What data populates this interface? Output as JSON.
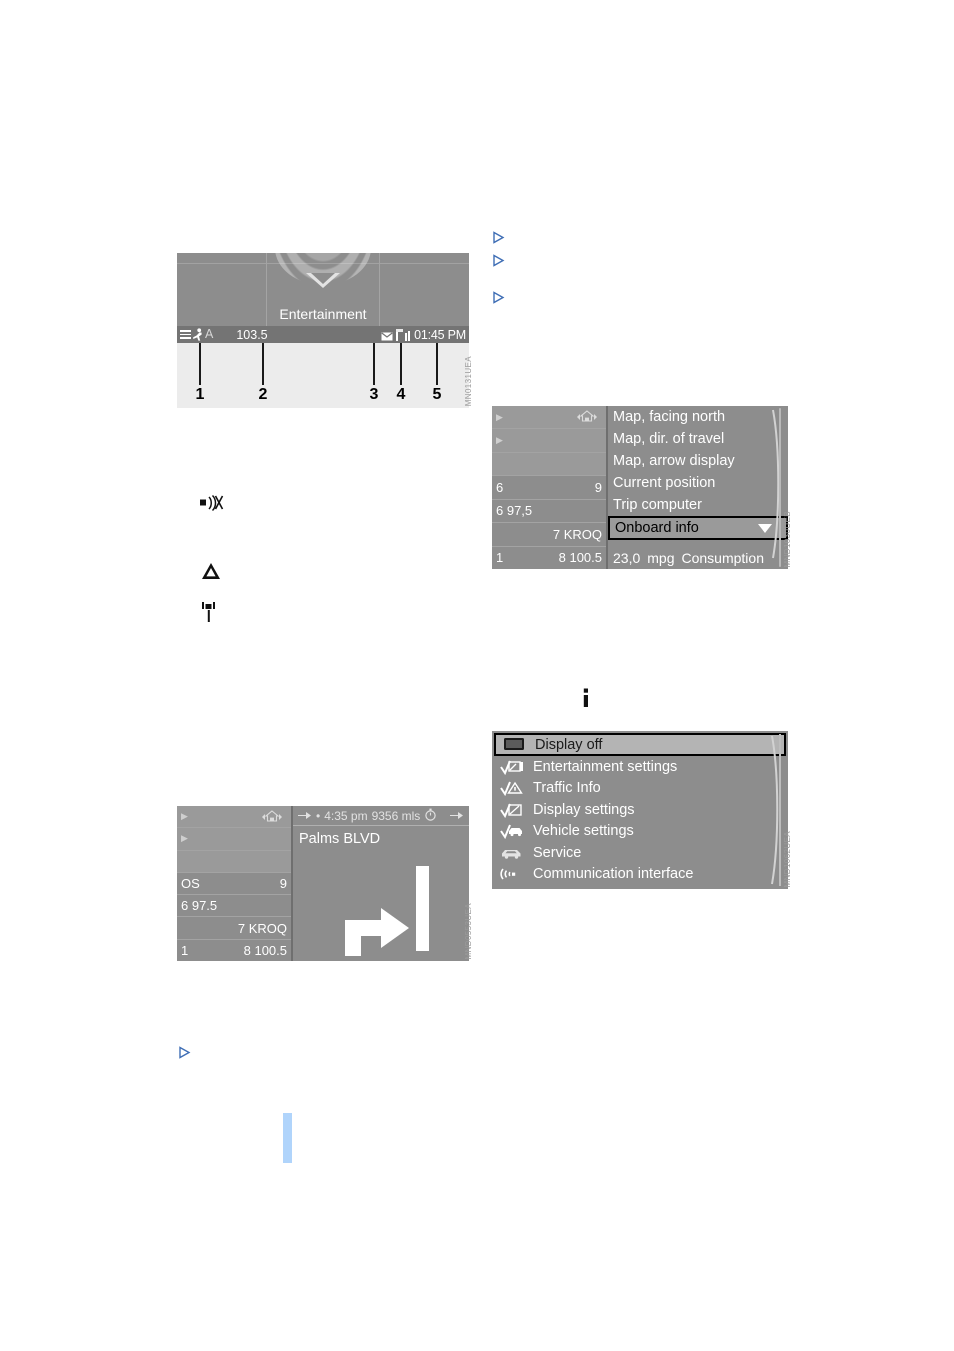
{
  "figures": {
    "status_bar": {
      "id": "fig-statusbar",
      "caption_code": "MN0131UEA",
      "tile_label": "Entertainment",
      "status": {
        "menu_icon": "hamburger-icon",
        "person_icon": "person-icon",
        "letter": "A",
        "frequency": "103.5",
        "envelope_icon": "envelope-icon",
        "signal_icon": "signal-bars-icon",
        "time": "01:45 PM"
      },
      "callouts": [
        "1",
        "2",
        "3",
        "4",
        "5"
      ]
    },
    "nav_menu": {
      "id": "fig-navmenu",
      "caption_code": "MND1030UEB",
      "left_rows": [
        {
          "left": "",
          "right": "",
          "arrow": true,
          "home": true
        },
        {
          "left": "",
          "right": "",
          "arrow": true,
          "home": false
        },
        {
          "left": "",
          "right": "",
          "arrow": false,
          "home": false
        },
        {
          "left": "6",
          "right": "9",
          "arrow": false,
          "home": false
        },
        {
          "left": "6 97,5",
          "right": "",
          "arrow": false,
          "home": false
        },
        {
          "left": "",
          "right": "7 KROQ",
          "arrow": false,
          "home": false
        },
        {
          "left": "1",
          "right": "8 100.5",
          "arrow": false,
          "home": false
        }
      ],
      "items": [
        "Map, facing north",
        "Map, dir. of travel",
        "Map, arrow display",
        "Current position",
        "Trip computer"
      ],
      "selected_item": "Onboard info",
      "footer": {
        "value": "23,0",
        "unit": "mpg",
        "label": "Consumption"
      }
    },
    "arrow_nav": {
      "id": "fig-arrownav",
      "caption_code": "MND0553UEA",
      "left_rows": [
        {
          "left": "",
          "right": "",
          "arrow": true,
          "home": true
        },
        {
          "left": "",
          "right": "",
          "arrow": true,
          "home": false
        },
        {
          "left": "",
          "right": "",
          "arrow": false,
          "home": false
        },
        {
          "left": "OS",
          "right": "9",
          "arrow": false,
          "home": false
        },
        {
          "left": "6 97.5",
          "right": "",
          "arrow": false,
          "home": false
        },
        {
          "left": "",
          "right": "7 KROQ",
          "arrow": false,
          "home": false
        },
        {
          "left": "1",
          "right": "8 100.5",
          "arrow": false,
          "home": false
        }
      ],
      "top_bar": {
        "arrival_time": "4:35 pm",
        "distance": "9356 mls",
        "clock_icon": "stopwatch-icon",
        "arrow_icon": "arrow-right-icon"
      },
      "street": "Palms BLVD"
    },
    "settings_menu": {
      "id": "fig-settings",
      "caption_code": "MND1062UEA",
      "items": [
        {
          "label": "Display off",
          "icon": "display-off-icon",
          "selected": true
        },
        {
          "label": "Entertainment settings",
          "icon": "entertainment-settings-icon",
          "selected": false
        },
        {
          "label": "Traffic Info",
          "icon": "traffic-info-icon",
          "selected": false
        },
        {
          "label": "Display settings",
          "icon": "display-settings-icon",
          "selected": false
        },
        {
          "label": "Vehicle settings",
          "icon": "vehicle-settings-icon",
          "selected": false
        },
        {
          "label": "Service",
          "icon": "service-car-icon",
          "selected": false
        },
        {
          "label": "Communication interface",
          "icon": "communication-interface-icon",
          "selected": false
        }
      ]
    }
  },
  "symbols": {
    "mute": "speaker-muted-icon",
    "warning": "warning-triangle-icon",
    "antenna": "antenna-icon",
    "info": "information-i-icon"
  },
  "bullets": {
    "icon": "triangle-bullet-icon",
    "count_right_top": 3,
    "count_left_bottom": 1
  },
  "colors": {
    "screen_bg": "#8d8d8d",
    "status_bar": "#747474",
    "panel_light": "#ececec",
    "bullet_blue": "#3f6eb5",
    "change_bar_blue": "#b0d4fb",
    "text_white": "#ffffff",
    "text_black": "#000000"
  }
}
